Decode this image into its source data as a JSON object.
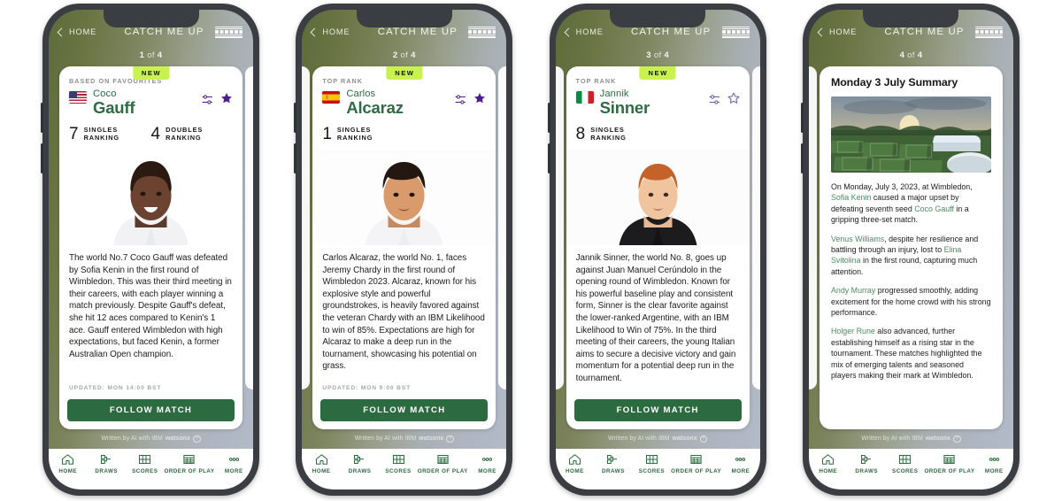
{
  "app": {
    "header": {
      "back_label": "HOME",
      "title": "CATCH ME UP",
      "brand": "IBM"
    },
    "footer_credit": {
      "prefix": "Written by AI with IBM",
      "brand": "watsonx",
      "help_icon": "?"
    },
    "tabbar": [
      {
        "icon": "home-icon",
        "label": "HOME"
      },
      {
        "icon": "draws-icon",
        "label": "DRAWS"
      },
      {
        "icon": "scores-icon",
        "label": "SCORES"
      },
      {
        "icon": "order-of-play-icon",
        "label": "ORDER OF PLAY"
      },
      {
        "icon": "more-icon",
        "label": "MORE"
      }
    ],
    "colors": {
      "accent_green": "#2c6b3f",
      "badge_lime": "#c9f14f",
      "link_green": "#4e8a63",
      "star_purple": "#4b1f8f"
    }
  },
  "screens": [
    {
      "pager": {
        "current": "1",
        "middle": "of",
        "total": "4"
      },
      "card": {
        "badge": "NEW",
        "kicker": "BASED ON FAVOURITES",
        "flag": "us",
        "first_name": "Coco",
        "last_name": "Gauff",
        "icons": {
          "settings": "sliders-icon",
          "favourite": "star-filled-icon"
        },
        "rankings": [
          {
            "value": "7",
            "label_line1": "SINGLES",
            "label_line2": "RANKING"
          },
          {
            "value": "4",
            "label_line1": "DOUBLES",
            "label_line2": "RANKING"
          }
        ],
        "body": "The world No.7 Coco Gauff was defeated by Sofia Kenin in the first round of Wimbledon. This was their third meeting in their careers, with each player winning a match previously. Despite Gauff's defeat, she hit 12 aces compared to Kenin's 1 ace. Gauff entered Wimbledon with high expectations, but faced Kenin, a former Australian Open champion.",
        "updated": "UPDATED: MON 14:00 BST",
        "cta": "FOLLOW MATCH"
      }
    },
    {
      "pager": {
        "current": "2",
        "middle": "of",
        "total": "4"
      },
      "card": {
        "badge": "NEW",
        "kicker": "TOP RANK",
        "flag": "es",
        "first_name": "Carlos",
        "last_name": "Alcaraz",
        "icons": {
          "settings": "sliders-icon",
          "favourite": "star-filled-icon"
        },
        "rankings": [
          {
            "value": "1",
            "label_line1": "SINGLES",
            "label_line2": "RANKING"
          }
        ],
        "body": "Carlos Alcaraz, the world No. 1, faces Jeremy Chardy in the first round of Wimbledon 2023. Alcaraz, known for his explosive style and powerful groundstrokes, is heavily favored against the veteran Chardy with an IBM Likelihood to win of 85%. Expectations are high for Alcaraz to make a deep run in the tournament, showcasing his potential on grass.",
        "updated": "UPDATED: MON 9:00 BST",
        "cta": "FOLLOW MATCH"
      }
    },
    {
      "pager": {
        "current": "3",
        "middle": "of",
        "total": "4"
      },
      "card": {
        "badge": "NEW",
        "kicker": "TOP RANK",
        "flag": "it",
        "first_name": "Jannik",
        "last_name": "Sinner",
        "icons": {
          "settings": "sliders-icon",
          "favourite": "star-outline-icon"
        },
        "rankings": [
          {
            "value": "8",
            "label_line1": "SINGLES",
            "label_line2": "RANKING"
          }
        ],
        "body": "Jannik Sinner, the world No. 8, goes up against Juan Manuel Cerúndolo in the opening round of Wimbledon. Known for his powerful baseline play and consistent form, Sinner is the clear favorite against the lower-ranked Argentine, with an IBM Likelihood to Win of 75%. In the third meeting of their careers, the young Italian aims to secure a decisive victory and gain momentum for a potential deep run in the tournament.",
        "updated": "",
        "cta": "FOLLOW MATCH"
      }
    },
    {
      "pager": {
        "current": "4",
        "middle": "of",
        "total": "4"
      },
      "summary": {
        "title": "Monday 3 July Summary",
        "image_alt": "wimbledon-grounds-aerial-photo",
        "paragraphs": [
          [
            {
              "t": "On Monday, July 3, 2023, at Wimbledon, ",
              "link": false
            },
            {
              "t": "Sofia Kenin",
              "link": true
            },
            {
              "t": " caused a major upset by defeating seventh seed ",
              "link": false
            },
            {
              "t": "Coco Gauff",
              "link": true
            },
            {
              "t": " in a gripping three-set match.",
              "link": false
            }
          ],
          [
            {
              "t": "Venus Williams",
              "link": true
            },
            {
              "t": ", despite her resilience and battling through an injury, lost to ",
              "link": false
            },
            {
              "t": "Elina Svitolina",
              "link": true
            },
            {
              "t": " in the first round, capturing much attention.",
              "link": false
            }
          ],
          [
            {
              "t": "Andy Murray",
              "link": true
            },
            {
              "t": " progressed smoothly, adding excitement for the home crowd with his strong performance.",
              "link": false
            }
          ],
          [
            {
              "t": "Holger Rune",
              "link": true
            },
            {
              "t": " also advanced, further establishing himself as a rising star in the tournament. These matches highlighted the mix of emerging talents and seasoned players making their mark at Wimbledon.",
              "link": false
            }
          ]
        ]
      }
    }
  ]
}
